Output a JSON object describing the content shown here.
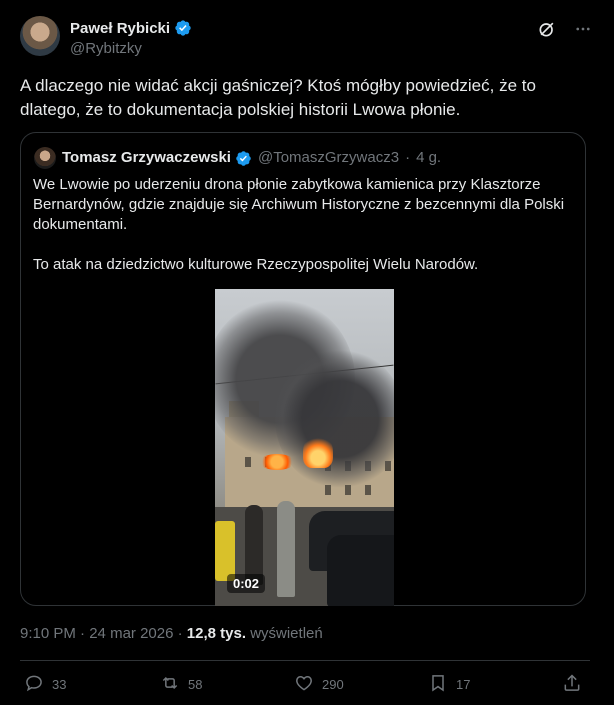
{
  "author": {
    "display_name": "Paweł Rybicki",
    "handle": "@Rybitzky"
  },
  "tweet_text": "A dlaczego nie widać akcji gaśniczej? Ktoś mógłby powiedzieć, że to dlatego, że to dokumentacja polskiej historii Lwowa płonie.",
  "quote": {
    "display_name": "Tomasz Grzywaczewski",
    "handle": "@TomaszGrzywacz3",
    "separator": "·",
    "time_ago": "4 g.",
    "paragraph_1": "We Lwowie po uderzeniu drona płonie zabytkowa kamienica przy Klasztorze Bernardynów, gdzie znajduje się Archiwum Historyczne z bezcennymi dla Polski dokumentami.",
    "paragraph_2": "To atak na dziedzictwo kulturowe Rzeczypospolitej Wielu Narodów.",
    "video_duration": "0:02"
  },
  "meta": {
    "time": "9:10 PM",
    "separator_1": "·",
    "date": "24 mar 2026",
    "separator_2": "·",
    "views_count": "12,8 tys.",
    "views_label": "wyświetleń"
  },
  "actions": {
    "replies": "33",
    "reposts": "58",
    "likes": "290",
    "bookmarks": "17"
  },
  "colors": {
    "background": "#000000",
    "text": "#e7e9ea",
    "secondary_text": "#71767b",
    "border": "#2f3336",
    "verified_blue": "#1d9bf0"
  },
  "icons": [
    "verified-badge-icon",
    "grok-icon",
    "more-icon",
    "reply-icon",
    "repost-icon",
    "like-icon",
    "bookmark-icon",
    "share-icon"
  ]
}
